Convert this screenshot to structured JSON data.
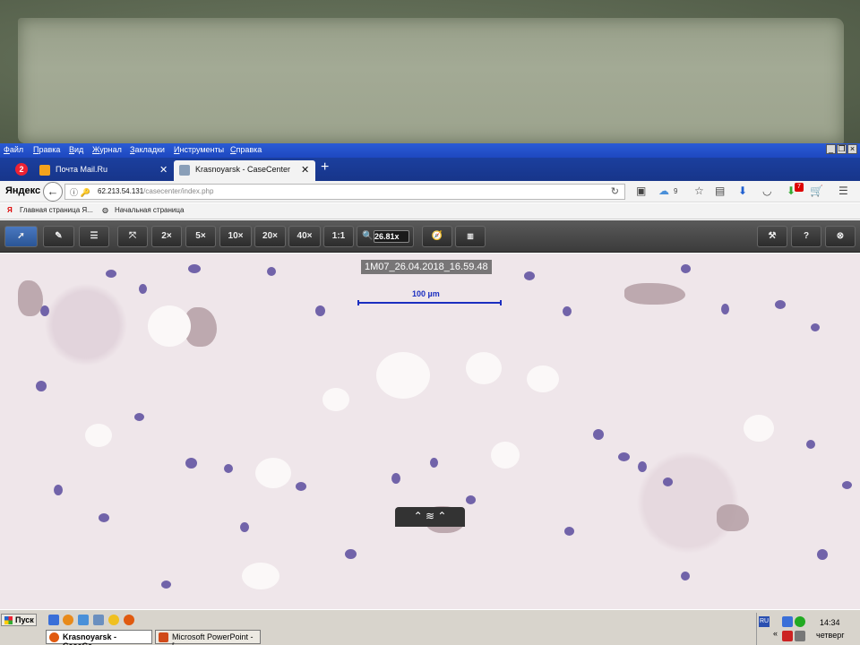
{
  "menubar": {
    "items": [
      "Файл",
      "Правка",
      "Вид",
      "Журнал",
      "Закладки",
      "Инструменты",
      "Справка"
    ]
  },
  "tabs": [
    {
      "label": "Почта Mail.Ru",
      "active": false
    },
    {
      "label": "Krasnoyarsk - CaseCenter",
      "active": true
    }
  ],
  "navbar": {
    "brand": "Яндекс",
    "url_host": "62.213.54.131",
    "url_path": "/casecenter/index.php",
    "cloud_count": "9",
    "notification_badge": "7"
  },
  "bookmarks": [
    {
      "label": "Главная страница Я..."
    },
    {
      "label": "Начальная страница"
    }
  ],
  "viewer_toolbar": {
    "zoom_buttons": [
      "2×",
      "5×",
      "10×",
      "20×",
      "40×",
      "1:1"
    ],
    "zoom_value": "26.81x",
    "right_buttons": [
      "?"
    ]
  },
  "slide": {
    "label": "1M07_26.04.2018_16.59.48",
    "scale_label": "100 µm"
  },
  "taskbar": {
    "start_label": "Пуск",
    "tasks": [
      {
        "label": "Krasnoyarsk - CaseCe...",
        "active": true
      },
      {
        "label": "Microsoft PowerPoint - [...",
        "active": false
      }
    ],
    "lang": "RU",
    "time": "14:34",
    "day": "четверг"
  },
  "colors": {
    "menubar": "#2a5bd5",
    "tabstrip": "#1b3f9e",
    "toolbar": "#3b3b3b",
    "active_tool": "#4a78c0",
    "nuclei": "#5b4b9d",
    "scalebar": "#1b2ec0"
  }
}
